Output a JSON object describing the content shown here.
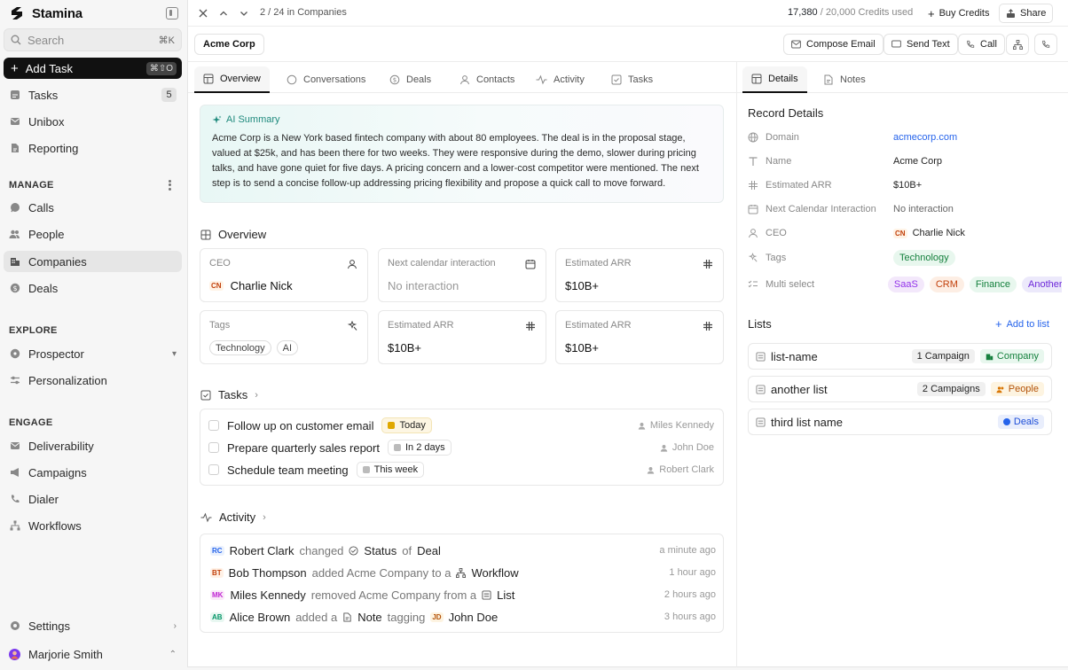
{
  "app": {
    "name": "Stamina"
  },
  "sidebar": {
    "search": {
      "placeholder": "Search",
      "shortcut": "⌘K"
    },
    "add_task": {
      "label": "Add Task",
      "shortcut": "⌘⇧O"
    },
    "top_items": [
      {
        "label": "Tasks",
        "count": "5"
      },
      {
        "label": "Unibox"
      },
      {
        "label": "Reporting"
      }
    ],
    "sections": {
      "manage": "MANAGE",
      "explore": "EXPLORE",
      "engage": "ENGAGE"
    },
    "manage_items": [
      "Calls",
      "People",
      "Companies",
      "Deals"
    ],
    "explore_items": [
      "Prospector",
      "Personalization"
    ],
    "engage_items": [
      "Deliverability",
      "Campaigns",
      "Dialer",
      "Workflows"
    ],
    "settings": "Settings",
    "user": "Marjorie Smith"
  },
  "topbar": {
    "pager": "2 / 24 in Companies",
    "credits_used": "17,380",
    "credits_total": "/ 20,000 Credits used",
    "buy_credits": "Buy Credits",
    "share": "Share"
  },
  "record": {
    "name": "Acme Corp",
    "actions": {
      "compose_email": "Compose Email",
      "send_text": "Send Text",
      "call": "Call"
    }
  },
  "tabs": [
    "Overview",
    "Conversations",
    "Deals",
    "Contacts",
    "Activity",
    "Tasks"
  ],
  "ai_summary": {
    "title": "AI Summary",
    "text": "Acme Corp is a New York based fintech company with about 80 employees. The deal is in the proposal stage, valued at $25k, and has been there for two weeks. They were responsive during the demo, slower during pricing talks, and have gone quiet for five days. A pricing concern and a lower-cost competitor were mentioned. The next step is to send a concise follow-up addressing pricing flexibility and propose a quick call to move forward."
  },
  "overview": {
    "title": "Overview",
    "cards": [
      {
        "label": "CEO",
        "initials": "CN",
        "value": "Charlie Nick"
      },
      {
        "label": "Next calendar interaction",
        "value": "No interaction"
      },
      {
        "label": "Estimated ARR",
        "value": "$10B+"
      },
      {
        "label": "Tags",
        "tags": [
          "Technology",
          "AI"
        ]
      },
      {
        "label": "Estimated ARR",
        "value": "$10B+"
      },
      {
        "label": "Estimated ARR",
        "value": "$10B+"
      }
    ]
  },
  "tasks": {
    "title": "Tasks",
    "items": [
      {
        "label": "Follow up on customer email",
        "due": "Today",
        "assignee": "Miles Kennedy"
      },
      {
        "label": "Prepare quarterly sales report",
        "due": "In 2 days",
        "assignee": "John Doe"
      },
      {
        "label": "Schedule team meeting",
        "due": "This week",
        "assignee": "Robert Clark"
      }
    ]
  },
  "activity": {
    "title": "Activity",
    "items": [
      {
        "initials": "RC",
        "actor": "Robert Clark",
        "verb": "changed",
        "object": "Status",
        "connector": "of",
        "target": "Deal",
        "time": "a minute ago"
      },
      {
        "initials": "BT",
        "actor": "Bob Thompson",
        "verb": "added Acme Company to a",
        "object": "Workflow",
        "time": "1 hour ago"
      },
      {
        "initials": "MK",
        "actor": "Miles Kennedy",
        "verb": "removed Acme Company from a",
        "object": "List",
        "time": "2 hours ago"
      },
      {
        "initials": "AB",
        "actor": "Alice Brown",
        "verb": "added a",
        "object": "Note",
        "connector": "tagging",
        "target_initials": "JD",
        "target": "John Doe",
        "time": "3 hours ago"
      }
    ]
  },
  "right_panel": {
    "tabs": [
      "Details",
      "Notes"
    ],
    "record_details_title": "Record Details",
    "details": [
      {
        "label": "Domain",
        "value": "acmecorp.com"
      },
      {
        "label": "Name",
        "value": "Acme Corp"
      },
      {
        "label": "Estimated ARR",
        "value": "$10B+"
      },
      {
        "label": "Next Calendar Interaction",
        "value": "No interaction"
      },
      {
        "label": "CEO",
        "initials": "CN",
        "value": "Charlie Nick"
      },
      {
        "label": "Tags",
        "value": "Technology"
      },
      {
        "label": "Multi select",
        "values": [
          "SaaS",
          "CRM",
          "Finance",
          "Another"
        ]
      }
    ],
    "lists_title": "Lists",
    "add_to_list": "Add to list",
    "lists": [
      {
        "name": "list-name",
        "count": "1 Campaign",
        "type": "Company"
      },
      {
        "name": "another list",
        "count": "2 Campaigns",
        "type": "People"
      },
      {
        "name": "third list name",
        "type": "Deals"
      }
    ]
  }
}
